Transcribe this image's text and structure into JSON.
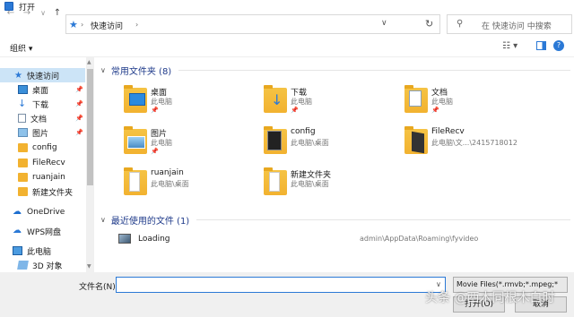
{
  "window": {
    "title": "打开"
  },
  "address": {
    "path": "快速访问",
    "search_placeholder": "在 快速访问 中搜索"
  },
  "toolbar": {
    "organize": "组织 ▾"
  },
  "sidebar": {
    "items": [
      {
        "label": "快速访问",
        "icon": "star-icon",
        "pinned": false
      },
      {
        "label": "桌面",
        "icon": "desktop-icon",
        "pinned": true
      },
      {
        "label": "下载",
        "icon": "download-icon",
        "pinned": true
      },
      {
        "label": "文档",
        "icon": "document-icon",
        "pinned": true
      },
      {
        "label": "图片",
        "icon": "picture-icon",
        "pinned": true
      },
      {
        "label": "config",
        "icon": "folder-icon",
        "pinned": false
      },
      {
        "label": "FileRecv",
        "icon": "folder-icon",
        "pinned": false
      },
      {
        "label": "ruanjain",
        "icon": "folder-icon",
        "pinned": false
      },
      {
        "label": "新建文件夹",
        "icon": "folder-icon",
        "pinned": false
      },
      {
        "label": "OneDrive",
        "icon": "cloud-icon",
        "pinned": false
      },
      {
        "label": "WPS网盘",
        "icon": "cloud-icon",
        "pinned": false
      },
      {
        "label": "此电脑",
        "icon": "computer-icon",
        "pinned": false
      },
      {
        "label": "3D 对象",
        "icon": "3d-objects-icon",
        "pinned": false
      }
    ]
  },
  "content": {
    "frequent_header": "常用文件夹 (8)",
    "recent_header": "最近使用的文件 (1)",
    "folders": [
      {
        "name": "桌面",
        "location": "此电脑"
      },
      {
        "name": "下载",
        "location": "此电脑"
      },
      {
        "name": "文档",
        "location": "此电脑"
      },
      {
        "name": "图片",
        "location": "此电脑"
      },
      {
        "name": "config",
        "location": "此电脑\\桌面"
      },
      {
        "name": "FileRecv",
        "location": "此电脑\\文...\\2415718012"
      },
      {
        "name": "ruanjain",
        "location": "此电脑\\桌面"
      },
      {
        "name": "新建文件夹",
        "location": "此电脑\\桌面"
      }
    ],
    "recent_files": [
      {
        "name": "Loading",
        "path": "admin\\AppData\\Roaming\\fyvideo"
      }
    ]
  },
  "footer": {
    "filename_label": "文件名(N):",
    "filename_value": "",
    "filetype": "Movie Files(*.rmvb;*.mpeg;*",
    "open_button": "打开(O)",
    "cancel_button": "取消",
    "watermark": "头条 @西木同根木白时"
  },
  "colors": {
    "accent": "#2b79d6",
    "selected": "#cce4f7",
    "group_header": "#1e3a8a"
  }
}
